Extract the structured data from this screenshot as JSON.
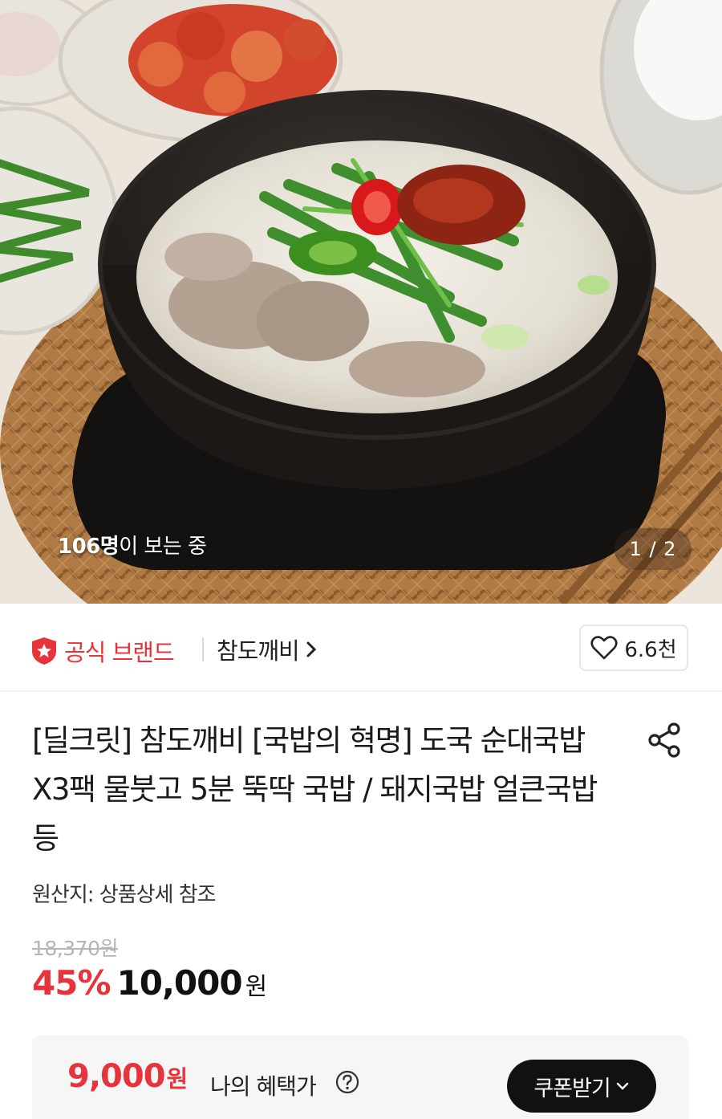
{
  "hero": {
    "viewer_count": "106명",
    "viewer_suffix": "이 보는 중",
    "page_indicator": "1 / 2"
  },
  "brand": {
    "badge_label": "공식 브랜드",
    "name": "참도깨비",
    "like_count": "6.6천"
  },
  "product": {
    "title": "[딜크릿] 참도깨비 [국밥의 혁명] 도국 순대국밥 X3팩 물붓고 5분 뚝딱 국밥 / 돼지국밥 얼큰국밥 등",
    "origin": "원산지: 상품상세 참조",
    "original_price": "18,370원",
    "discount_rate": "45%",
    "sale_price": "10,000",
    "sale_unit": "원"
  },
  "benefit": {
    "price": "9,000",
    "unit": "원",
    "label": "나의 혜택가",
    "coupon_button": "쿠폰받기"
  },
  "colors": {
    "accent": "#e8333a",
    "dark_button": "#111111",
    "benefit_bg": "#f6f6f6"
  }
}
